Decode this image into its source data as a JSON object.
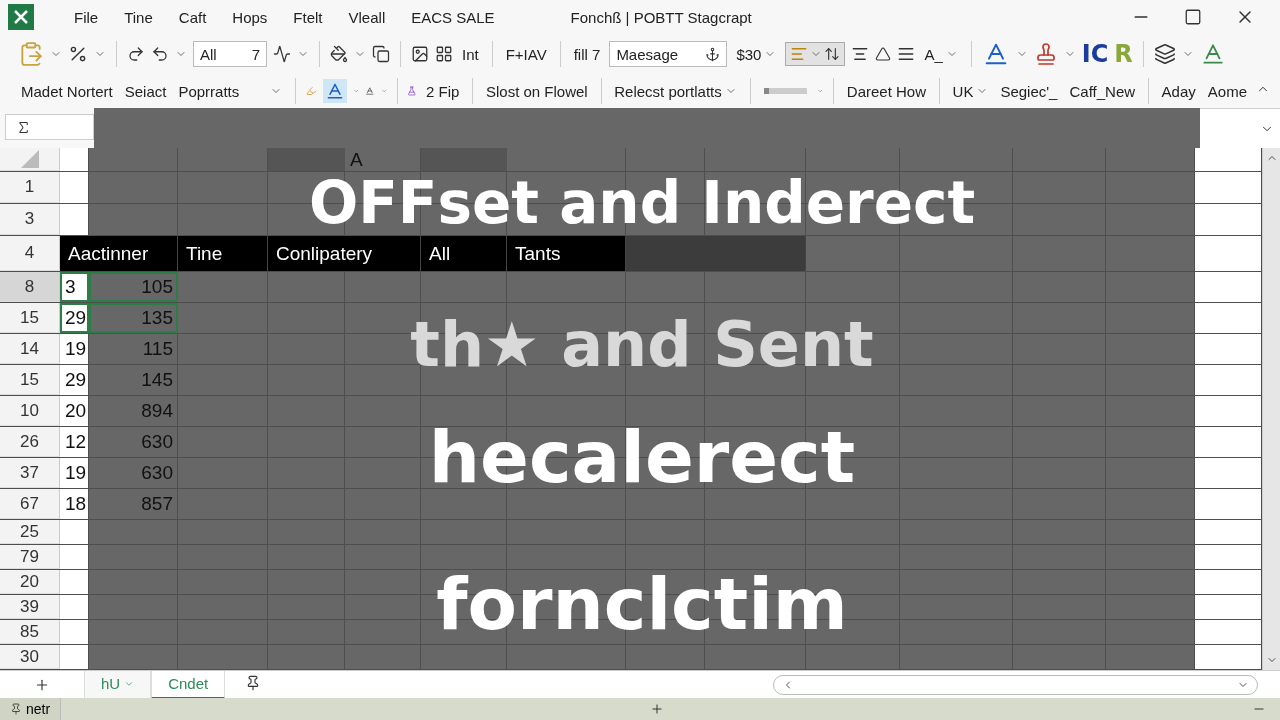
{
  "titlebar": {
    "menu": [
      "File",
      "Tine",
      "Caft",
      "Hops",
      "Ftelt",
      "Vleall",
      "EACS SALE"
    ],
    "title": "Fonchß | POBTT Stagcrapt"
  },
  "ribbon": {
    "font_field": {
      "value": "All",
      "suffix": "7"
    },
    "labels": [
      "Int",
      "F+IAV",
      "fill 7"
    ],
    "style_field": {
      "value": "Maesage"
    },
    "currency": "$30",
    "align_toggle": {
      "selected": true
    },
    "font_size": "A_",
    "letters": [
      "IC",
      "R"
    ],
    "row2": {
      "left": [
        "Madet Nortert",
        "Seiact"
      ],
      "dropdown": "Poprratts",
      "fip": "2 Fip",
      "sort": "Slost on Flowel",
      "select": "Relecst portlatts",
      "slider": {
        "level": 0.12
      },
      "direct": "Dareet How",
      "lang": "UK",
      "names": [
        "Segiec'_",
        "Caff_New",
        "Aday",
        "Aome"
      ]
    }
  },
  "grid": {
    "column_header": "A",
    "row_numbers": [
      "1",
      "3",
      "4",
      "8",
      "15",
      "14",
      "15",
      "10",
      "26",
      "37",
      "67",
      "25",
      "79",
      "20",
      "39",
      "85",
      "30"
    ],
    "header_row": [
      "Aactinner",
      "Tine",
      "Conlipatery",
      "All",
      "Tants"
    ],
    "rows": [
      {
        "cells": [
          "3",
          "105"
        ],
        "selected": true
      },
      {
        "cells": [
          "29",
          "135"
        ],
        "selected": true
      },
      {
        "cells": [
          "19",
          "115"
        ],
        "selected": false
      },
      {
        "cells": [
          "29",
          "145"
        ],
        "selected": false
      },
      {
        "cells": [
          "20",
          "894"
        ],
        "selected": false
      },
      {
        "cells": [
          "12",
          "630"
        ],
        "selected": false
      },
      {
        "cells": [
          "19",
          "630"
        ],
        "selected": false
      },
      {
        "cells": [
          "18",
          "857"
        ],
        "selected": false
      }
    ]
  },
  "overlay": {
    "lines": [
      "OFFset and Inderect",
      "th★ and Sent",
      "hecalerect",
      "fornclctim"
    ]
  },
  "sheet_tabs": [
    {
      "label": "hU",
      "selected": false
    },
    {
      "label": "Cndet",
      "selected": true
    }
  ],
  "status_bar": {
    "label": "netr"
  }
}
